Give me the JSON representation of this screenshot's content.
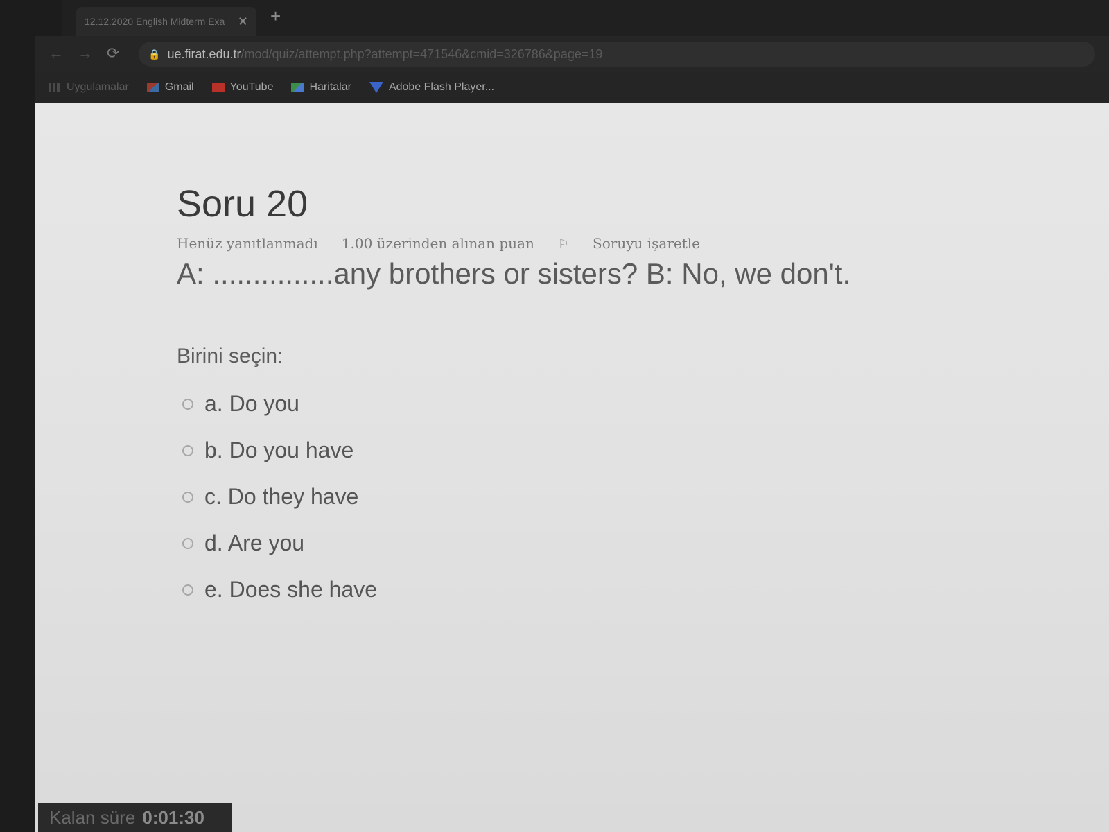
{
  "browser": {
    "tab": {
      "title": "12.12.2020 English Midterm Exa",
      "close": "✕"
    },
    "new_tab": "+",
    "url": {
      "host": "ue.firat.edu.tr",
      "path": "/mod/quiz/attempt.php?attempt=471546&cmid=326786&page=19"
    },
    "bookmarks": [
      {
        "label": "Uygulamalar",
        "icon": "apps-icon"
      },
      {
        "label": "Gmail",
        "icon": "gmail-icon"
      },
      {
        "label": "YouTube",
        "icon": "youtube-icon"
      },
      {
        "label": "Haritalar",
        "icon": "maps-icon"
      },
      {
        "label": "Adobe Flash Player...",
        "icon": "adobe-icon"
      }
    ]
  },
  "question": {
    "title": "Soru 20",
    "status": "Henüz yanıtlanmadı",
    "points": "1.00 üzerinden alınan puan",
    "flag_label": "Soruyu işaretle",
    "text": "A: ...............any brothers or sisters? B: No, we don't.",
    "prompt": "Birini seçin:",
    "options": [
      {
        "label": "a. Do you"
      },
      {
        "label": "b. Do you have"
      },
      {
        "label": "c. Do they have"
      },
      {
        "label": "d. Are you"
      },
      {
        "label": "e. Does she have"
      }
    ]
  },
  "timer": {
    "label": "Kalan süre",
    "value": "0:01:30"
  }
}
